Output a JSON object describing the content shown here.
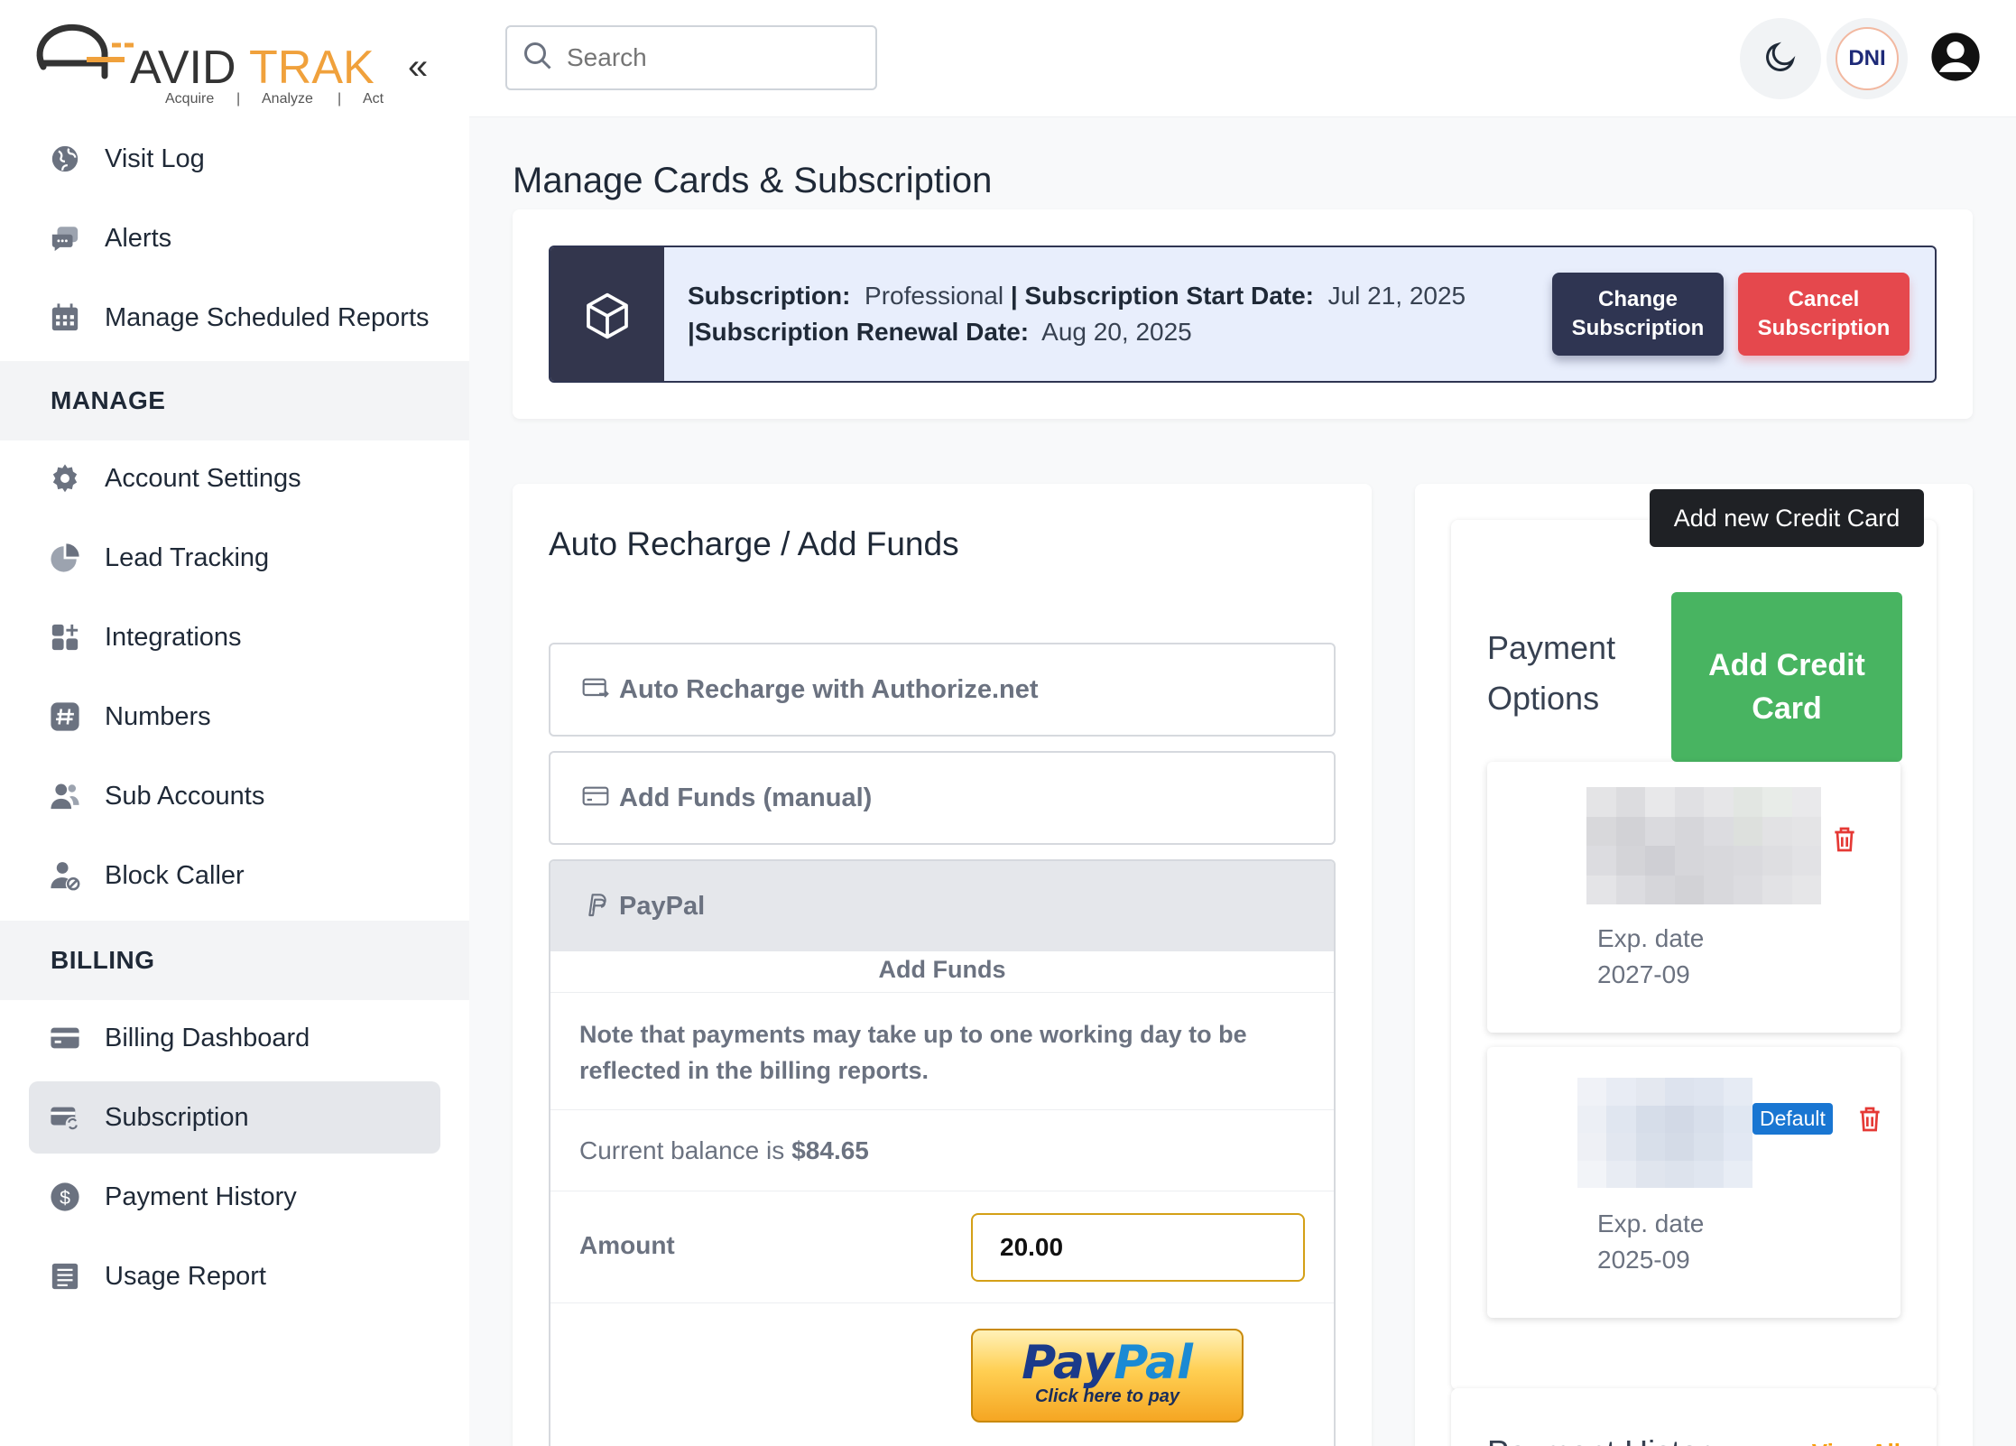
{
  "brand": {
    "logo_text": "AVIDTRAK",
    "tagline": [
      "Acquire",
      "|",
      "Analyze",
      "|",
      "Act"
    ]
  },
  "sidebar": {
    "collapse_icon": "double-chevron-left-icon",
    "top_items": [
      {
        "label": "Visit Log",
        "icon": "globe-icon"
      },
      {
        "label": "Alerts",
        "icon": "chat-bubble-icon"
      },
      {
        "label": "Manage Scheduled Reports",
        "icon": "calendar-icon"
      }
    ],
    "manage_header": "MANAGE",
    "manage_items": [
      {
        "label": "Account Settings",
        "icon": "gear-icon"
      },
      {
        "label": "Lead Tracking",
        "icon": "pie-chart-icon"
      },
      {
        "label": "Integrations",
        "icon": "apps-plus-icon"
      },
      {
        "label": "Numbers",
        "icon": "hash-icon"
      },
      {
        "label": "Sub Accounts",
        "icon": "users-icon"
      },
      {
        "label": "Block Caller",
        "icon": "user-block-icon"
      }
    ],
    "billing_header": "BILLING",
    "billing_items": [
      {
        "label": "Billing Dashboard",
        "icon": "credit-card-icon"
      },
      {
        "label": "Subscription",
        "icon": "card-refresh-icon",
        "active": true
      },
      {
        "label": "Payment History",
        "icon": "dollar-circle-icon"
      },
      {
        "label": "Usage Report",
        "icon": "list-doc-icon"
      }
    ]
  },
  "topbar": {
    "search_placeholder": "Search",
    "avatar_initials": "DNI",
    "theme_icon": "moon-icon",
    "profile_icon": "user-circle-icon"
  },
  "page": {
    "title": "Manage Cards & Subscription"
  },
  "subscription": {
    "plan_label": "Subscription:",
    "plan_value": "Professional",
    "start_label": "| Subscription Start Date:",
    "start_value": "Jul 21, 2025",
    "renewal_label": "|Subscription Renewal Date:",
    "renewal_value": "Aug 20, 2025",
    "change_button": "Change Subscription",
    "cancel_button": "Cancel Subscription"
  },
  "funds": {
    "title": "Auto Recharge / Add Funds",
    "auto_recharge_label": "Auto Recharge with Authorize.net",
    "manual_label": "Add Funds (manual)",
    "paypal_label": "PayPal",
    "add_funds_header": "Add Funds",
    "note": "Note that payments may take up to one working day to be reflected in the billing reports.",
    "balance_prefix": "Current balance is",
    "balance_value": "$84.65",
    "amount_label": "Amount",
    "amount_value": "20.00",
    "paypal_button_pay": "Pay",
    "paypal_button_pal": "Pal",
    "paypal_button_sub": "Click here to pay"
  },
  "payment_options": {
    "title": "Payment Options",
    "add_button": "Add Credit Card",
    "tooltip": "Add new Credit Card",
    "cards": [
      {
        "exp_label": "Exp. date",
        "exp_value": "2027-09",
        "default": false
      },
      {
        "exp_label": "Exp. date",
        "exp_value": "2025-09",
        "default": true,
        "badge": "Default"
      }
    ],
    "history_title": "Payment History",
    "view_all": "View All"
  },
  "colors": {
    "sidebar_active": "#e5e7eb",
    "banner_dark": "#33364d",
    "change_btn": "#2f3552",
    "cancel_btn": "#e5484d",
    "add_card_btn": "#48b461",
    "default_badge": "#1976d2",
    "delete_icon": "#e53935",
    "logo_orange": "#f0a13c"
  }
}
